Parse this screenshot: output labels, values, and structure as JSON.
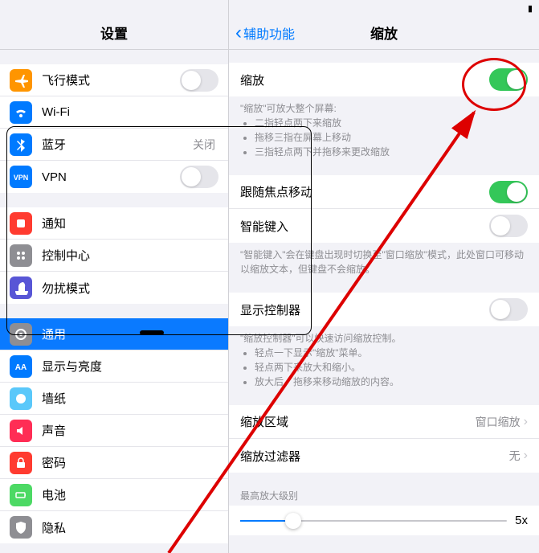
{
  "statusBar": {
    "battery": ""
  },
  "left": {
    "title": "设置",
    "groups": [
      [
        {
          "icon": "airplane",
          "color": "#ff9500",
          "label": "飞行模式",
          "toggle": "off"
        },
        {
          "icon": "wifi",
          "color": "#007aff",
          "label": "Wi-Fi",
          "detail": ""
        },
        {
          "icon": "bluetooth",
          "color": "#007aff",
          "label": "蓝牙",
          "detail": "关闭"
        },
        {
          "icon": "vpn",
          "color": "#007aff",
          "label": "VPN",
          "toggle": "off"
        }
      ],
      [
        {
          "icon": "notify",
          "color": "#ff3b30",
          "label": "通知"
        },
        {
          "icon": "control",
          "color": "#8e8e93",
          "label": "控制中心"
        },
        {
          "icon": "dnd",
          "color": "#5856d6",
          "label": "勿扰模式"
        }
      ],
      [
        {
          "icon": "general",
          "color": "#8e8e93",
          "label": "通用",
          "selected": true
        },
        {
          "icon": "display",
          "color": "#007aff",
          "label": "显示与亮度"
        },
        {
          "icon": "wallpaper",
          "color": "#5ac8fa",
          "label": "墙纸"
        },
        {
          "icon": "sound",
          "color": "#ff2d55",
          "label": "声音"
        },
        {
          "icon": "passcode",
          "color": "#ff3b30",
          "label": "密码"
        },
        {
          "icon": "battery",
          "color": "#4cd964",
          "label": "电池"
        },
        {
          "icon": "privacy",
          "color": "#8e8e93",
          "label": "隐私"
        }
      ]
    ]
  },
  "right": {
    "back": "辅助功能",
    "title": "缩放",
    "zoom": {
      "label": "缩放",
      "on": true
    },
    "zoomDesc": {
      "intro": "\"缩放\"可放大整个屏幕:",
      "b1": "二指轻点两下来缩放",
      "b2": "拖移三指在屏幕上移动",
      "b3": "三指轻点两下并拖移来更改缩放"
    },
    "followFocus": {
      "label": "跟随焦点移动",
      "on": true
    },
    "smartType": {
      "label": "智能键入",
      "on": false
    },
    "smartTypeDesc": "\"智能键入\"会在键盘出现时切换至\"窗口缩放\"模式，此处窗口可移动以缩放文本，但键盘不会缩放。",
    "showController": {
      "label": "显示控制器",
      "on": false
    },
    "controllerDesc": {
      "intro": "\"缩放控制器\"可以快速访问缩放控制。",
      "b1": "轻点一下显示\"缩放\"菜单。",
      "b2": "轻点两下来放大和缩小。",
      "b3": "放大后，拖移来移动缩放的内容。"
    },
    "zoomRegion": {
      "label": "缩放区域",
      "value": "窗口缩放"
    },
    "zoomFilter": {
      "label": "缩放过滤器",
      "value": "无"
    },
    "maxLevel": {
      "header": "最高放大级别",
      "value": "5x"
    }
  }
}
